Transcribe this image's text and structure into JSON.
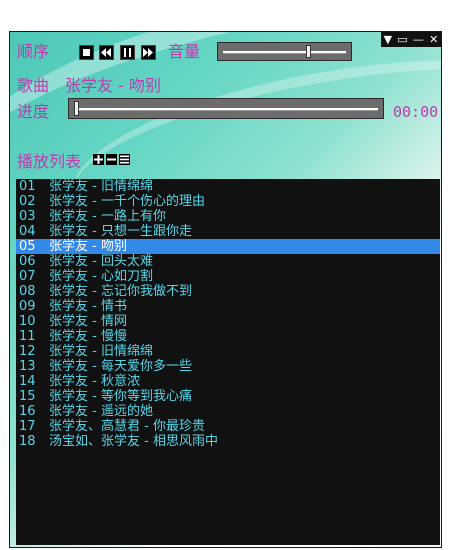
{
  "window": {
    "buttons": [
      {
        "name": "menu-icon",
        "glyph": "▼"
      },
      {
        "name": "restore-icon",
        "glyph": "▭"
      },
      {
        "name": "minimize-icon",
        "glyph": "—"
      },
      {
        "name": "close-icon",
        "glyph": "✕"
      }
    ]
  },
  "controls": {
    "mode_label": "顺序",
    "volume_label": "音量",
    "volume_level": 0.7
  },
  "now_playing": {
    "song_label": "歌曲",
    "song_title": "张学友 - 吻别",
    "progress_label": "进度",
    "progress_level": 0.0,
    "time": "00:00"
  },
  "playlist": {
    "label": "播放列表",
    "selected_index": 4,
    "items": [
      {
        "num": "01",
        "title": "张学友 - 旧情绵绵"
      },
      {
        "num": "02",
        "title": "张学友 - 一千个伤心的理由"
      },
      {
        "num": "03",
        "title": "张学友 - 一路上有你"
      },
      {
        "num": "04",
        "title": "张学友 - 只想一生跟你走"
      },
      {
        "num": "05",
        "title": "张学友 - 吻别"
      },
      {
        "num": "06",
        "title": "张学友 - 回头太难"
      },
      {
        "num": "07",
        "title": "张学友 - 心如刀割"
      },
      {
        "num": "08",
        "title": "张学友 - 忘记你我做不到"
      },
      {
        "num": "09",
        "title": "张学友 - 情书"
      },
      {
        "num": "10",
        "title": "张学友 - 情网"
      },
      {
        "num": "11",
        "title": "张学友 - 慢慢"
      },
      {
        "num": "12",
        "title": "张学友 - 旧情绵绵"
      },
      {
        "num": "13",
        "title": "张学友 - 每天爱你多一些"
      },
      {
        "num": "14",
        "title": "张学友 - 秋意浓"
      },
      {
        "num": "15",
        "title": "张学友 - 等你等到我心痛"
      },
      {
        "num": "16",
        "title": "张学友 - 遥远的她"
      },
      {
        "num": "17",
        "title": "张学友、高慧君 - 你最珍贵"
      },
      {
        "num": "18",
        "title": "汤宝如、张学友 - 相思风雨中"
      }
    ]
  },
  "colors": {
    "label": "#c03ab0",
    "list_text": "#56d6ea",
    "list_bg": "#111111",
    "selected_bg": "#3389e8"
  }
}
